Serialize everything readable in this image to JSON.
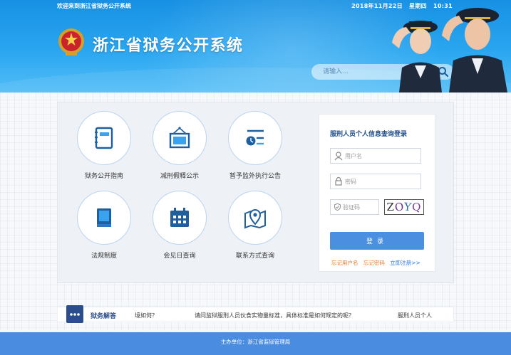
{
  "topbar": {
    "welcome": "欢迎来到浙江省狱务公开系统",
    "date": "2018年11月22日",
    "weekday": "星期四",
    "time": "10:31"
  },
  "header": {
    "title": "浙江省狱务公开系统",
    "search_placeholder": "请输入..."
  },
  "tiles": [
    {
      "label": "狱务公开指南",
      "icon": "notebook-icon"
    },
    {
      "label": "减刑假释公示",
      "icon": "notice-board-icon"
    },
    {
      "label": "暂予监外执行公告",
      "icon": "clock-list-icon"
    },
    {
      "label": "法规制度",
      "icon": "book-icon"
    },
    {
      "label": "会见日查询",
      "icon": "calendar-icon"
    },
    {
      "label": "联系方式查询",
      "icon": "map-pin-icon"
    }
  ],
  "login": {
    "title": "服刑人员个人信息查询登录",
    "username_placeholder": "用户名",
    "password_placeholder": "密码",
    "captcha_placeholder": "验证码",
    "captcha_text": "ZOYQ",
    "button": "登录",
    "forgot_username": "忘记用户名",
    "forgot_password": "忘记密码",
    "register": "立即注册>>"
  },
  "news": {
    "title": "狱务解答",
    "items": [
      "境如何？",
      "请问监狱服刑人员伙食实物量标准，具体标准是如何规定的呢？",
      "服刑人员个人"
    ]
  },
  "footer": {
    "text": "主办单位：浙江省监狱管理局"
  },
  "colors": {
    "header_blue": "#1790e3",
    "accent_blue": "#4a8fe0",
    "navy": "#2c4d8c",
    "link_orange": "#e87a2b"
  }
}
